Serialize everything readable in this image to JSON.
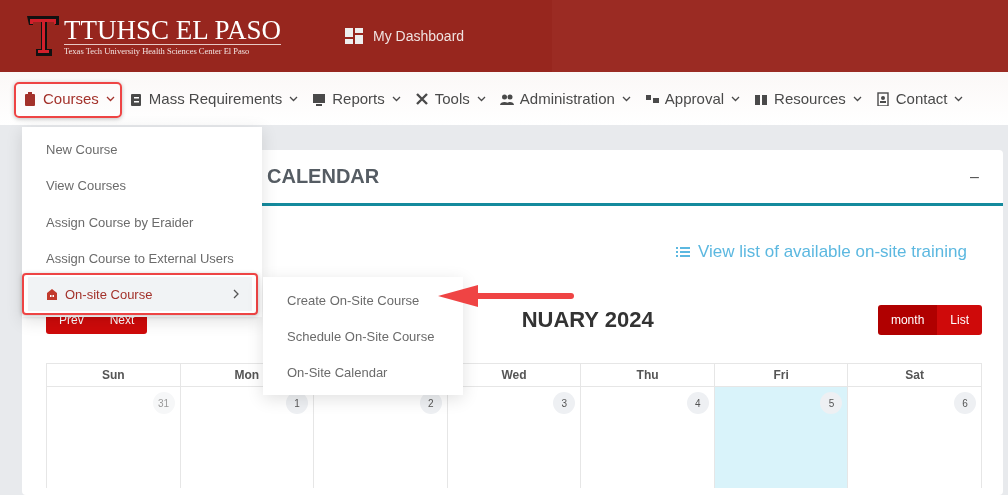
{
  "header": {
    "logo_title": "TTUHSC EL PASO",
    "logo_subtitle": "Texas Tech University Health Sciences Center El Paso",
    "dashboard_link": "My Dashboard"
  },
  "nav": [
    {
      "label": "Courses",
      "selected": true
    },
    {
      "label": "Mass Requirements",
      "selected": false
    },
    {
      "label": "Reports",
      "selected": false
    },
    {
      "label": "Tools",
      "selected": false
    },
    {
      "label": "Administration",
      "selected": false
    },
    {
      "label": "Approval",
      "selected": false
    },
    {
      "label": "Resources",
      "selected": false
    },
    {
      "label": "Contact",
      "selected": false
    }
  ],
  "card": {
    "title": "CALENDAR",
    "collapse": "–",
    "link": "View list of available on-site training",
    "month_title": "NUARY 2024",
    "nav_buttons": [
      "Prev",
      "Next"
    ],
    "view_buttons": [
      {
        "label": "month",
        "selected": true
      },
      {
        "label": "List",
        "selected": false
      }
    ],
    "columns": [
      {
        "weekday": "Sun",
        "day": "31",
        "muted": true,
        "today": false
      },
      {
        "weekday": "Mon",
        "day": "1",
        "muted": false,
        "today": false
      },
      {
        "day": "2",
        "muted": false,
        "today": false
      },
      {
        "weekday": "Wed",
        "day": "3",
        "muted": false,
        "today": false
      },
      {
        "weekday": "Thu",
        "day": "4",
        "muted": false,
        "today": false
      },
      {
        "weekday": "Fri",
        "day": "5",
        "muted": false,
        "today": true
      },
      {
        "weekday": "Sat",
        "day": "6",
        "muted": false,
        "today": false
      }
    ]
  },
  "menu": {
    "items": [
      {
        "label": "New Course",
        "submenu": false,
        "selected": false,
        "highlighted": false
      },
      {
        "label": "View Courses",
        "submenu": false,
        "selected": false,
        "highlighted": false
      },
      {
        "label": "Assign Course by Eraider",
        "submenu": false,
        "selected": false,
        "highlighted": false
      },
      {
        "label": "Assign Course to External Users",
        "submenu": false,
        "selected": false,
        "highlighted": false
      },
      {
        "label": "On-site Course",
        "submenu": true,
        "selected": true,
        "highlighted": true
      }
    ],
    "submenu": [
      {
        "label": "Create On-Site Course"
      },
      {
        "label": "Schedule On-Site Course"
      },
      {
        "label": "On-Site Calendar"
      }
    ]
  },
  "annotations": [
    {
      "kind": "arrow"
    }
  ]
}
